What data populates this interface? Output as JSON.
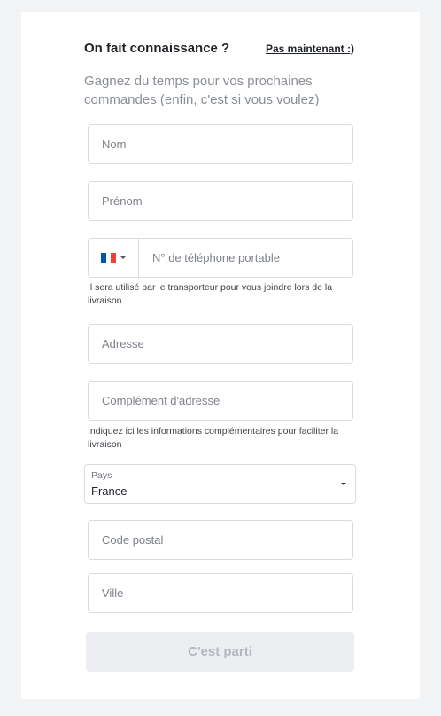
{
  "header": {
    "title": "On fait connaissance ?",
    "skip_link": "Pas maintenant :)"
  },
  "subtitle": "Gagnez du temps pour vos prochaines commandes (enfin, c'est si vous voulez)",
  "fields": {
    "nom": {
      "placeholder": "Nom"
    },
    "prenom": {
      "placeholder": "Prénom"
    },
    "telephone": {
      "placeholder": "N° de téléphone portable",
      "country_flag": "fr-flag-icon",
      "flag_colors": [
        "#0055a4",
        "#ffffff",
        "#ef4135"
      ],
      "hint": "Il sera utilisé par le transporteur pour vous joindre lors de la livraison"
    },
    "adresse": {
      "placeholder": "Adresse"
    },
    "complement": {
      "placeholder": "Complément d'adresse",
      "hint": "Indiquez ici les informations complémentaires pour faciliter la livraison"
    },
    "pays": {
      "label": "Pays",
      "value": "France"
    },
    "code_postal": {
      "placeholder": "Code postal"
    },
    "ville": {
      "placeholder": "Ville"
    }
  },
  "submit": {
    "label": "C'est parti",
    "state": "disabled"
  },
  "colors": {
    "background": "#f2f3f5",
    "card": "#ffffff",
    "border": "#d8dbe0",
    "disabled_button": "#eceef1",
    "disabled_text": "#b4b8be"
  }
}
